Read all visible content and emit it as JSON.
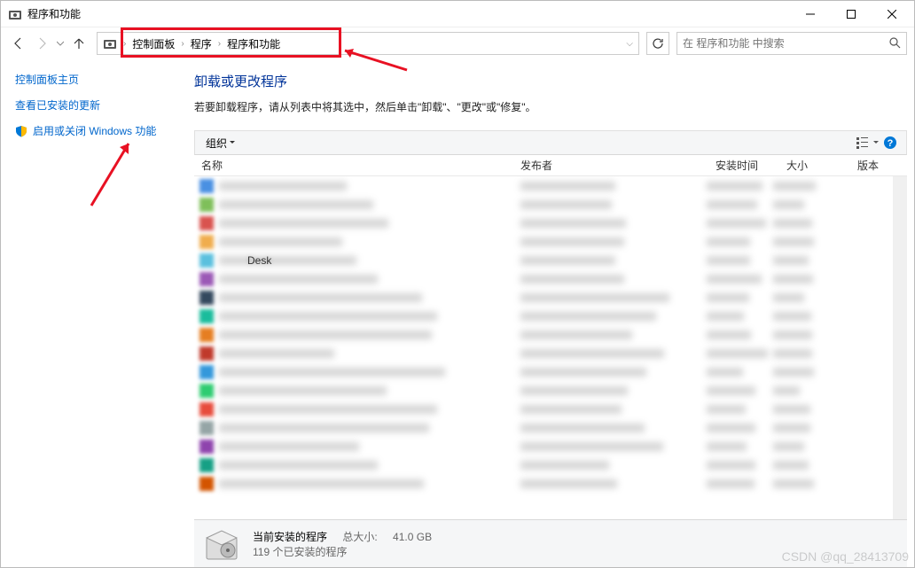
{
  "titlebar": {
    "title": "程序和功能"
  },
  "breadcrumb": {
    "items": [
      "控制面板",
      "程序",
      "程序和功能"
    ]
  },
  "search": {
    "placeholder": "在 程序和功能 中搜索"
  },
  "sidebar": {
    "home": "控制面板主页",
    "updates": "查看已安装的更新",
    "features": "启用或关闭 Windows 功能"
  },
  "main": {
    "heading": "卸载或更改程序",
    "description": "若要卸载程序，请从列表中将其选中，然后单击\"卸载\"、\"更改\"或\"修复\"。"
  },
  "toolbar": {
    "organize": "组织"
  },
  "columns": {
    "name": "名称",
    "publisher": "发布者",
    "install_date": "安装时间",
    "size": "大小",
    "version": "版本"
  },
  "list": {
    "fragment": "Desk"
  },
  "status": {
    "title": "当前安装的程序",
    "total_size_label": "总大小:",
    "total_size_value": "41.0 GB",
    "count_text": "119 个已安装的程序"
  },
  "watermark": "CSDN @qq_28413709",
  "icon_colors": [
    "#4a90e2",
    "#7fbf5a",
    "#d9534f",
    "#f0ad4e",
    "#5bc0de",
    "#9b59b6",
    "#34495e",
    "#1abc9c",
    "#e67e22",
    "#c0392b",
    "#3498db",
    "#2ecc71",
    "#e74c3c",
    "#95a5a6",
    "#8e44ad",
    "#16a085",
    "#d35400"
  ]
}
